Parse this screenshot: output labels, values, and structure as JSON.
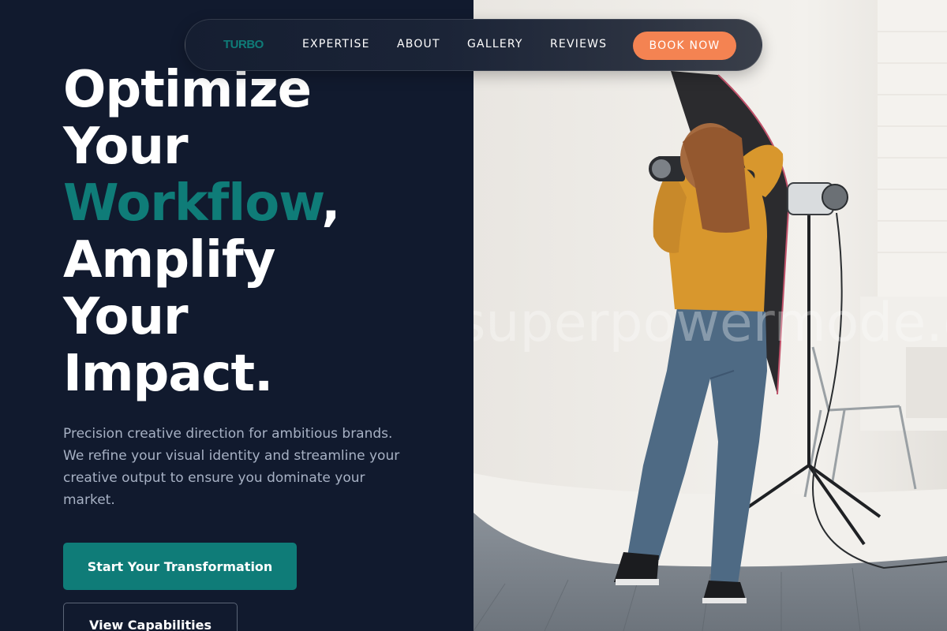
{
  "nav": {
    "logo": "TURBO",
    "links": [
      "EXPERTISE",
      "ABOUT",
      "GALLERY",
      "REVIEWS"
    ],
    "cta": "BOOK NOW"
  },
  "hero": {
    "headline": {
      "line1": "Optimize",
      "line2": "Your",
      "accent": "Workflow",
      "comma": ",",
      "line4": "Amplify",
      "line5": "Your",
      "line6": "Impact."
    },
    "subtext": "Precision creative direction for ambitious brands. We refine your visual identity and streamline your creative output to ensure you dominate your market.",
    "primary_cta": "Start Your Transformation",
    "secondary_cta": "View Capabilities"
  },
  "photo": {
    "watermark": "superpowermode.com"
  },
  "colors": {
    "background": "#111a2e",
    "accent": "#0f7c78",
    "cta_orange": "#f48352",
    "body_text": "#a7b1c4"
  }
}
